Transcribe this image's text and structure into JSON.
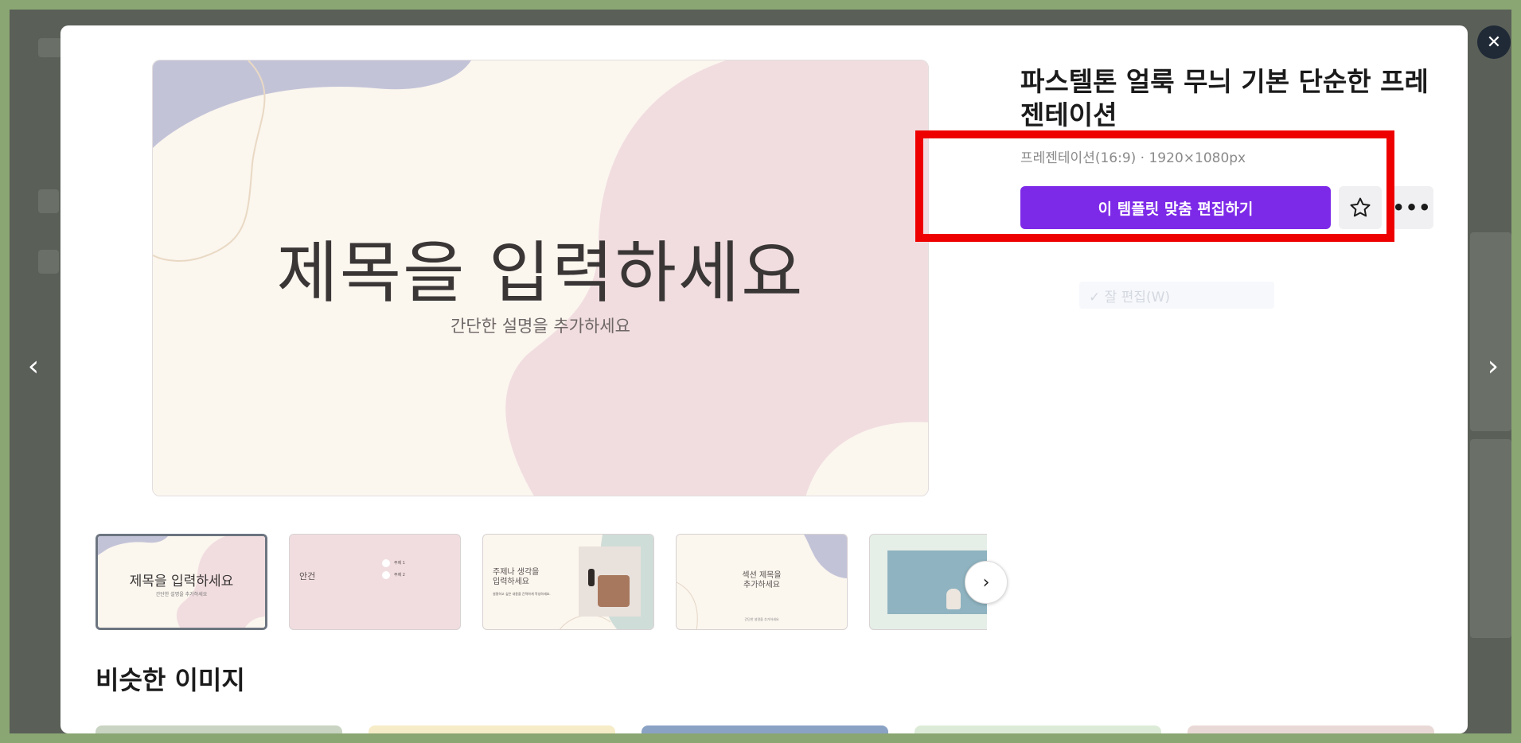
{
  "template": {
    "title": "파스텔톤 얼룩 무늬 기본 단순한 프레젠테이션",
    "meta": "프레젠테이션(16:9) · 1920×1080px",
    "edit_button": "이 템플릿 맞춤 편집하기",
    "faded_label": "✓ 잘 편집(W)"
  },
  "preview": {
    "heading": "제목을 입력하세요",
    "subheading": "간단한 설명을 추가하세요"
  },
  "thumbnails": [
    {
      "title": "제목을 입력하세요",
      "sub": "간단한 설명을 추가하세요"
    },
    {
      "title": "안건",
      "item1": "주제 1",
      "item2": "주제 2"
    },
    {
      "title": "주제나 생각을\n입력하세요",
      "sub": "설명하고 싶은 내용을 간략하게 작성하세요."
    },
    {
      "title": "섹션 제목을\n추가하세요",
      "sub": "간단한 설명을 추가하세요"
    },
    {
      "title": ""
    }
  ],
  "similar": {
    "heading": "비슷한 이미지"
  },
  "icons": {
    "close": "close-icon",
    "prev": "chevron-left-icon",
    "next": "chevron-right-icon",
    "star": "star-icon",
    "more": "more-icon"
  },
  "colors": {
    "accent": "#7d2ae8",
    "highlight": "#ee0000",
    "preview_pink": "#f1dde0",
    "preview_cream": "#fbf6ee",
    "preview_lavender": "#c3c3d8"
  }
}
